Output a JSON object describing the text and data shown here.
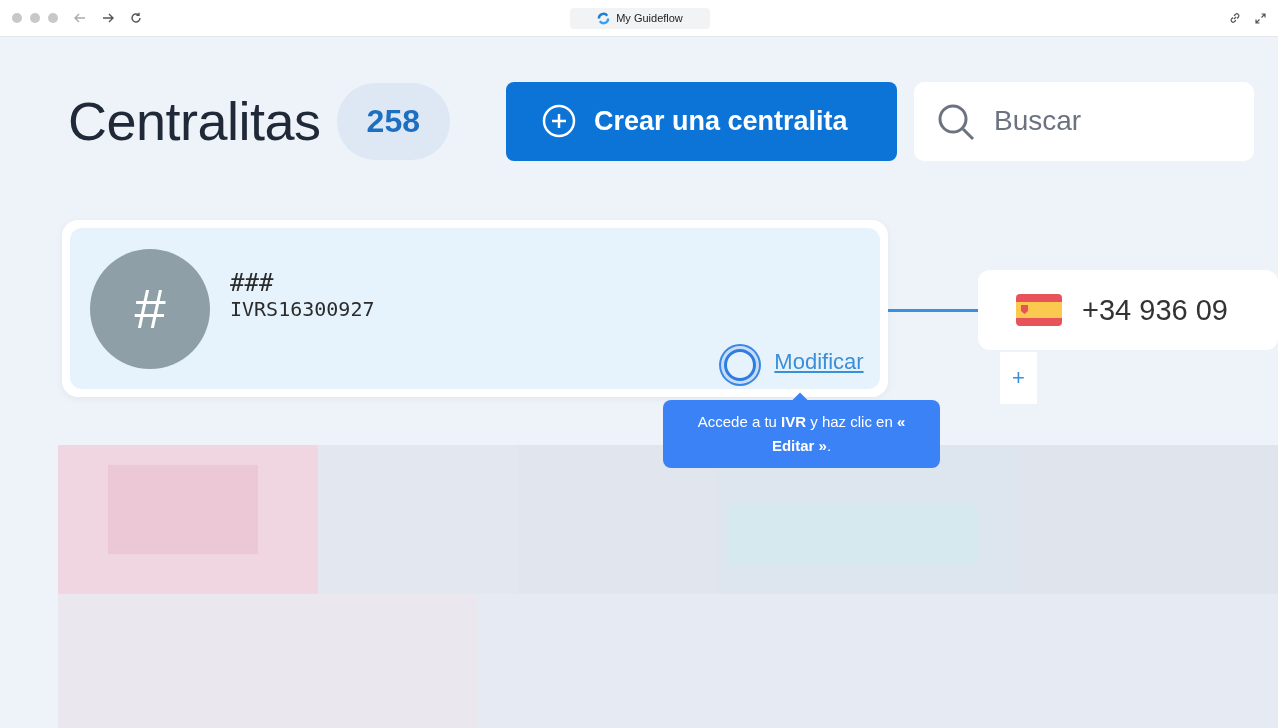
{
  "browser": {
    "tab_title": "My Guideflow"
  },
  "header": {
    "title": "Centralitas",
    "count": "258",
    "create_button": "Crear una centralita",
    "search": {
      "placeholder": "Buscar"
    }
  },
  "ivr_card": {
    "avatar": "#",
    "name": "###",
    "code": "IVRS16300927",
    "edit_link": "Modificar"
  },
  "number_card": {
    "phone": "+34 936 09",
    "add_button": "+"
  },
  "tooltip": {
    "text": "Accede a tu **IVR** y haz clic en **« Editar »**."
  }
}
